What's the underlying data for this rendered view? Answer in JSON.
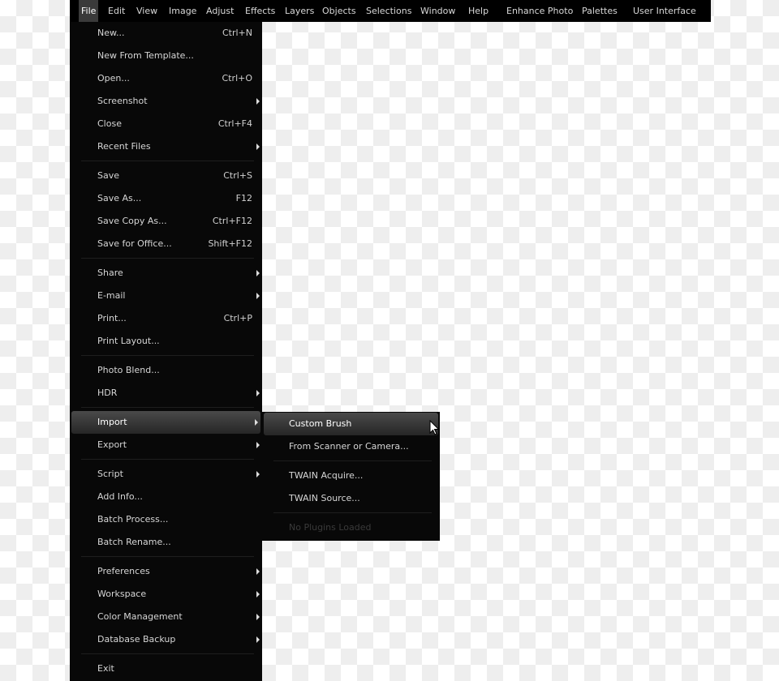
{
  "menubar": [
    "File",
    "Edit",
    "View",
    "Image",
    "Adjust",
    "Effects",
    "Layers",
    "Objects",
    "Selections",
    "Window",
    "Help",
    "Enhance Photo",
    "Palettes",
    "User Interface"
  ],
  "file_menu": {
    "groups": [
      [
        {
          "label": "New...",
          "shortcut": "Ctrl+N"
        },
        {
          "label": "New From Template..."
        },
        {
          "label": "Open...",
          "shortcut": "Ctrl+O"
        },
        {
          "label": "Screenshot",
          "submenu": true
        },
        {
          "label": "Close",
          "shortcut": "Ctrl+F4"
        },
        {
          "label": "Recent Files",
          "submenu": true
        }
      ],
      [
        {
          "label": "Save",
          "shortcut": "Ctrl+S"
        },
        {
          "label": "Save As...",
          "shortcut": "F12"
        },
        {
          "label": "Save Copy As...",
          "shortcut": "Ctrl+F12"
        },
        {
          "label": "Save for Office...",
          "shortcut": "Shift+F12"
        }
      ],
      [
        {
          "label": "Share",
          "submenu": true
        },
        {
          "label": "E-mail",
          "submenu": true
        },
        {
          "label": "Print...",
          "shortcut": "Ctrl+P"
        },
        {
          "label": "Print Layout..."
        }
      ],
      [
        {
          "label": "Photo Blend..."
        },
        {
          "label": "HDR",
          "submenu": true
        }
      ],
      [
        {
          "label": "Import",
          "submenu": true,
          "highlighted": true
        },
        {
          "label": "Export",
          "submenu": true
        }
      ],
      [
        {
          "label": "Script",
          "submenu": true
        },
        {
          "label": "Add Info..."
        },
        {
          "label": "Batch Process..."
        },
        {
          "label": "Batch Rename..."
        }
      ],
      [
        {
          "label": "Preferences",
          "submenu": true
        },
        {
          "label": "Workspace",
          "submenu": true
        },
        {
          "label": "Color Management",
          "submenu": true
        },
        {
          "label": "Database Backup",
          "submenu": true
        }
      ],
      [
        {
          "label": "Exit"
        }
      ]
    ]
  },
  "import_submenu": {
    "groups": [
      [
        {
          "label": "Custom Brush",
          "highlighted": true
        },
        {
          "label": "From Scanner or Camera..."
        }
      ],
      [
        {
          "label": "TWAIN Acquire..."
        },
        {
          "label": "TWAIN Source..."
        }
      ],
      [
        {
          "label": "No Plugins Loaded",
          "disabled": true
        }
      ]
    ]
  }
}
